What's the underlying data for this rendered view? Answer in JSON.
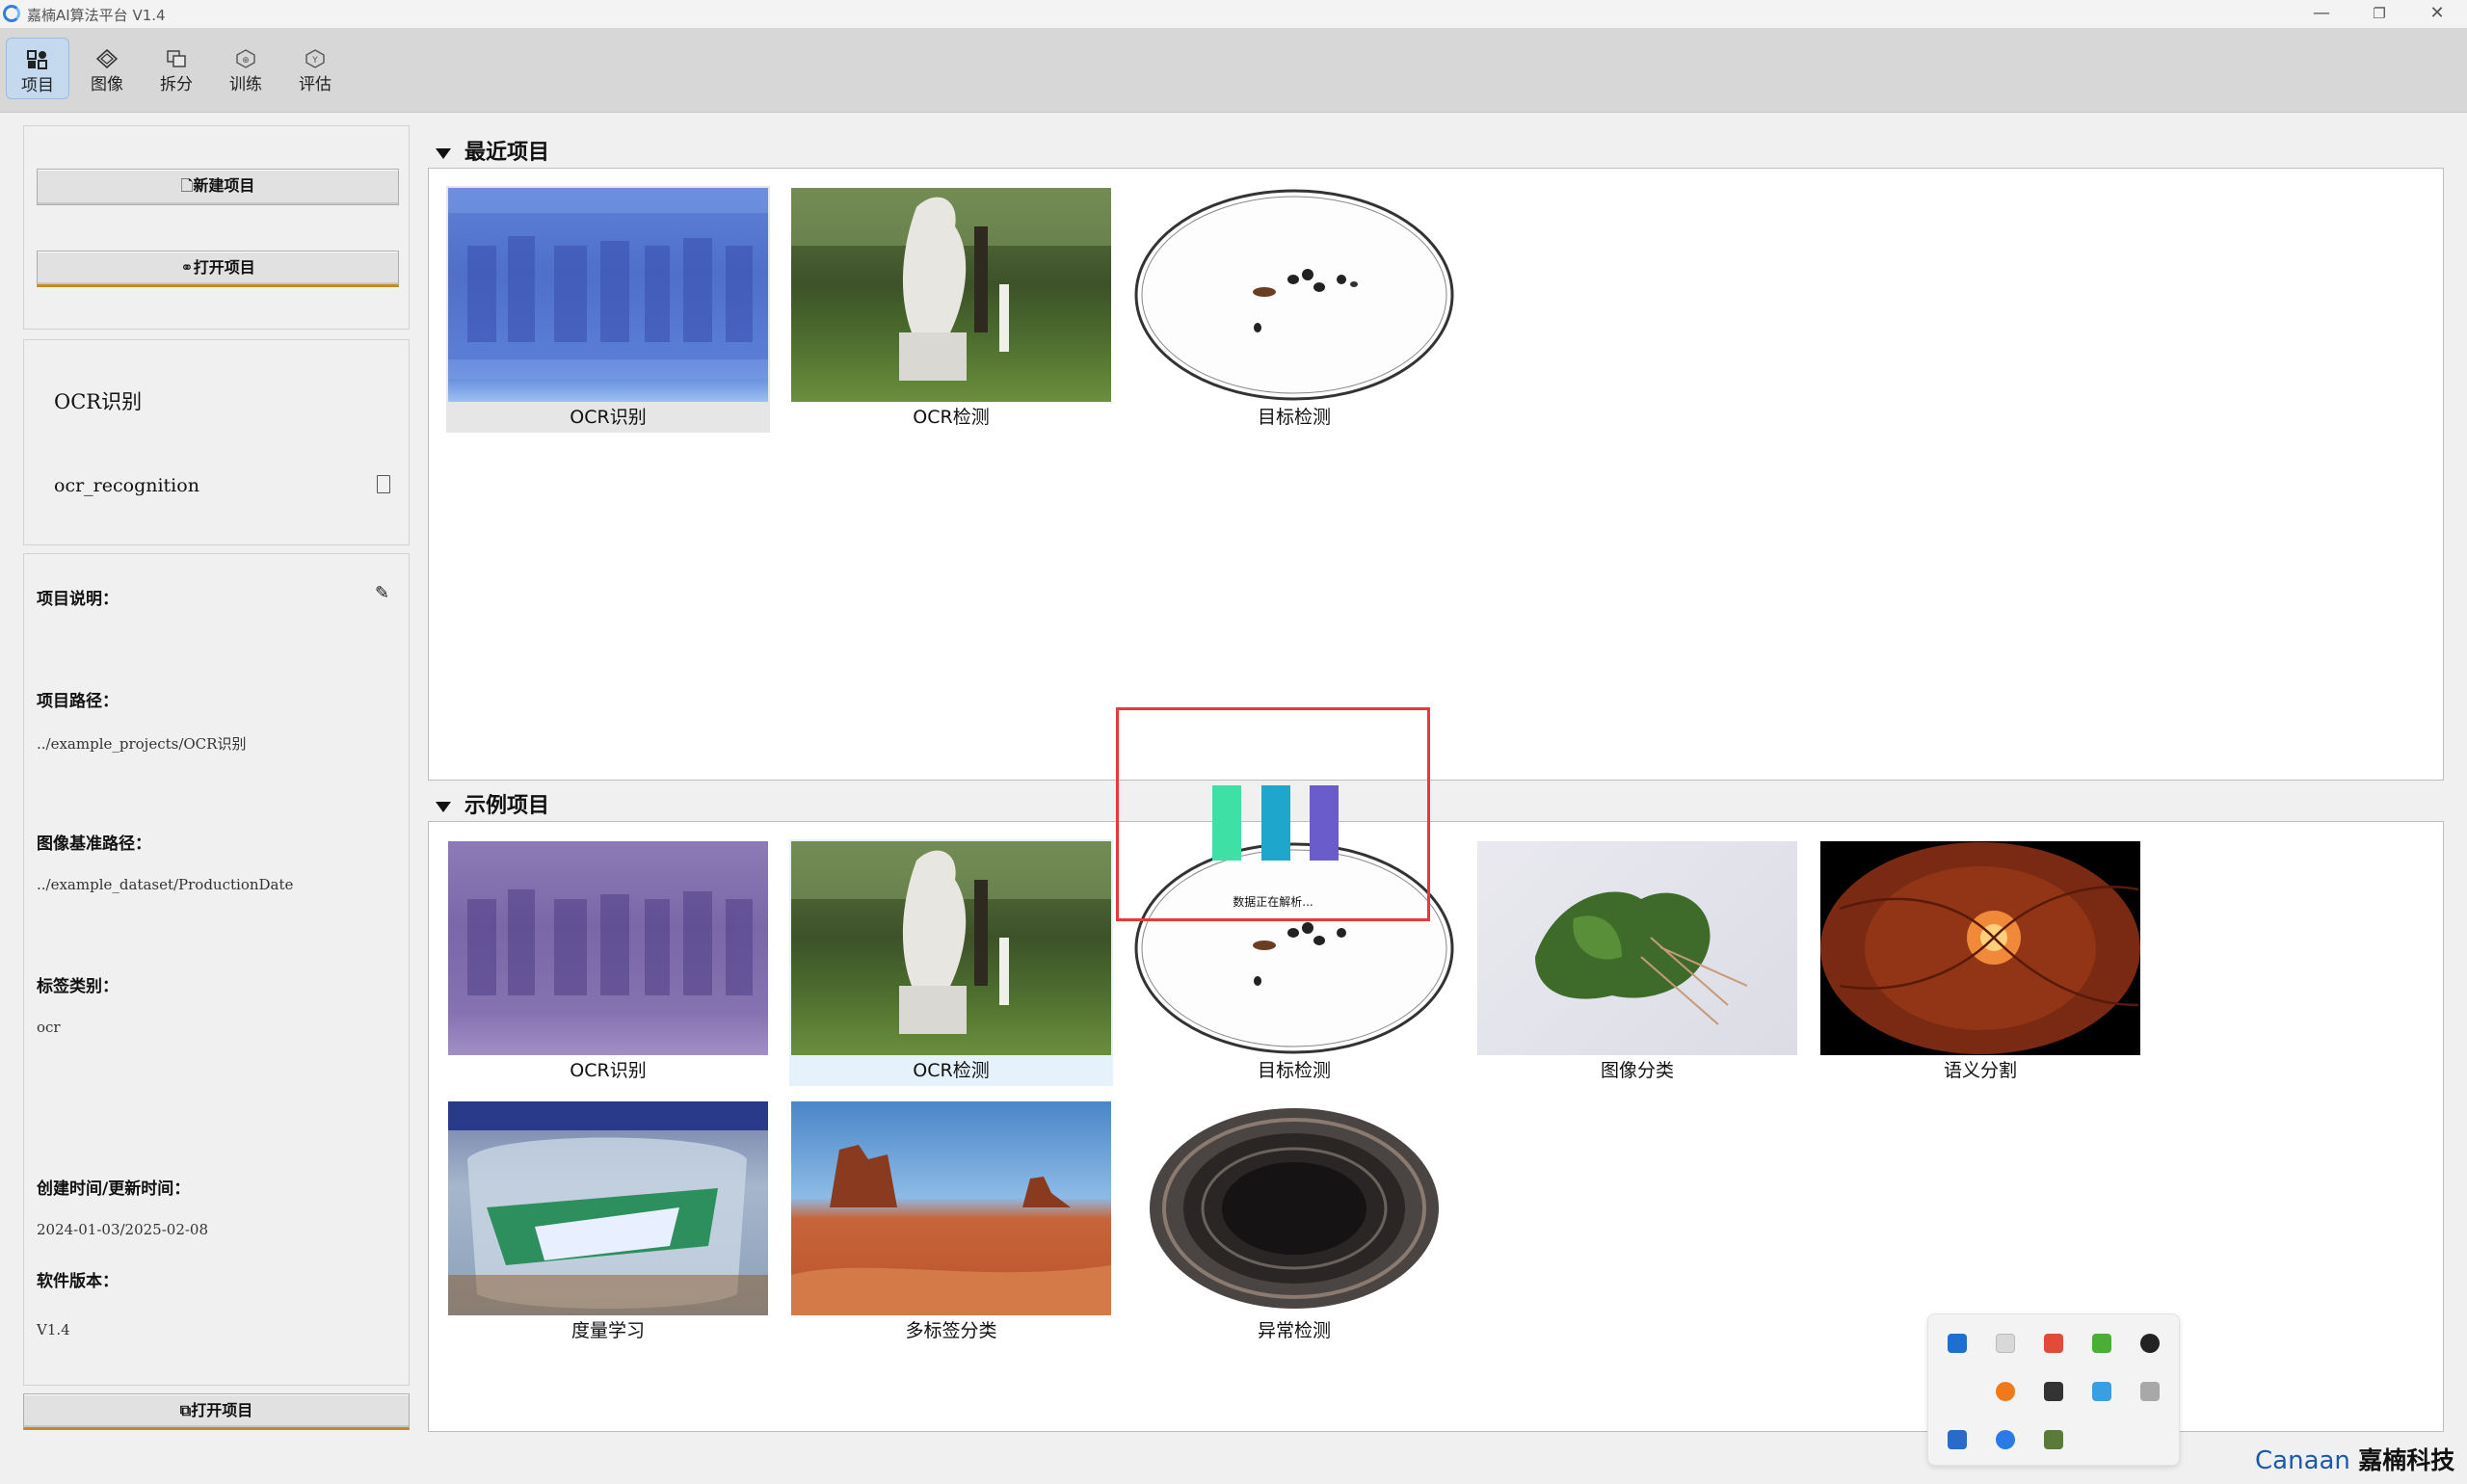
{
  "window": {
    "title": "嘉楠AI算法平台 V1.4",
    "minimize": "—",
    "restore": "❐",
    "close": "✕"
  },
  "toolbar": {
    "items": [
      {
        "label": "项目",
        "icon": "project-icon",
        "active": true
      },
      {
        "label": "图像",
        "icon": "image-icon"
      },
      {
        "label": "拆分",
        "icon": "split-icon"
      },
      {
        "label": "训练",
        "icon": "train-icon"
      },
      {
        "label": "评估",
        "icon": "evaluate-icon"
      }
    ]
  },
  "sidebar": {
    "new_project": "新建项目",
    "open_project": "打开项目",
    "project_name": "OCR识别",
    "project_id": "ocr_recognition",
    "fields": {
      "desc_label": "项目说明：",
      "path_label": "项目路径：",
      "path_value": "../example_projects/OCR识别",
      "img_path_label": "图像基准路径：",
      "img_path_value": "../example_dataset/ProductionDate",
      "tag_label": "标签类别：",
      "tag_value": "ocr",
      "time_label": "创建时间/更新时间：",
      "time_value": "2024-01-03/2025-02-08",
      "version_label": "软件版本：",
      "version_value": "V1.4"
    },
    "open_bottom": "打开项目"
  },
  "recent": {
    "title": "最近项目",
    "items": [
      {
        "caption": "OCR识别",
        "thumb": "ocr-text-thumb"
      },
      {
        "caption": "OCR检测",
        "thumb": "statue-thumb"
      },
      {
        "caption": "目标检测",
        "thumb": "insects-dish-thumb"
      }
    ]
  },
  "examples": {
    "title": "示例项目",
    "items": [
      {
        "caption": "OCR识别"
      },
      {
        "caption": "OCR检测"
      },
      {
        "caption": "目标检测"
      },
      {
        "caption": "图像分类"
      },
      {
        "caption": "语义分割"
      },
      {
        "caption": "度量学习"
      },
      {
        "caption": "多标签分类"
      },
      {
        "caption": "异常检测"
      }
    ]
  },
  "loading": {
    "text": "数据正在解析...",
    "colors": [
      "#3ee0a6",
      "#1fa6cc",
      "#6a5ccb"
    ]
  },
  "brand": {
    "en": "Canaan",
    "cn": "嘉楠科技"
  },
  "colors": {
    "accent": "#e5393b",
    "brand": "#1a5aa8",
    "active_tool": "#c4d9ee"
  }
}
